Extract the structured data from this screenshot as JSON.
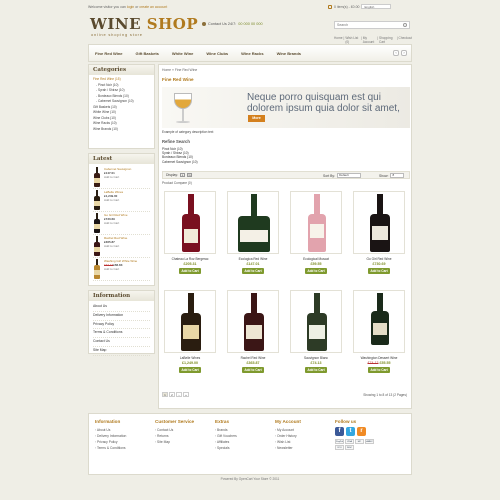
{
  "top": {
    "welcome_text": "Welcome visitor you can",
    "login_link": "login",
    "or_text": "or",
    "create_link": "create an account",
    "cart_text": "0 item(s) - £0.00",
    "language": "English"
  },
  "header": {
    "logo_main": "WINE",
    "logo_accent": "SHOP",
    "tagline": "online shoping store",
    "contact_label": "Contact Us 24/7:",
    "contact_number": "00 000 00 000",
    "search_placeholder": "Search",
    "links": [
      "Home",
      "Wish List (0)",
      "My Account",
      "Shopping Cart",
      "Checkout"
    ]
  },
  "nav": {
    "items": [
      "Fine Red Wine",
      "Gift Baskets",
      "White Wine",
      "Wine Clubs",
      "Wine Racks",
      "Wine Brands"
    ],
    "prev": "‹",
    "next": "›"
  },
  "sidebar": {
    "categories_title": "Categories",
    "categories": [
      {
        "label": "Fine Red Wine (15)",
        "active": true,
        "sub": false
      },
      {
        "label": "- Pinot Noir (10)",
        "active": false,
        "sub": true
      },
      {
        "label": "- Syrah / Shiraz (10)",
        "active": false,
        "sub": true
      },
      {
        "label": "- Bordeaux Blends (10)",
        "active": false,
        "sub": true
      },
      {
        "label": "- Cabernet Sauvignon (10)",
        "active": false,
        "sub": true
      },
      {
        "label": "Gift Baskets (10)",
        "active": false,
        "sub": false
      },
      {
        "label": "White Wine (10)",
        "active": false,
        "sub": false
      },
      {
        "label": "Wine Clubs (10)",
        "active": false,
        "sub": false
      },
      {
        "label": "Wine Racks (10)",
        "active": false,
        "sub": false
      },
      {
        "label": "Wine Brands (10)",
        "active": false,
        "sub": false
      }
    ],
    "latest_title": "Latest",
    "latest": [
      {
        "name": "Cabernet Sauvignon",
        "price": "£147.01",
        "old": "",
        "add": "Add to Cart"
      },
      {
        "name": "LaBelle Wines",
        "price": "£1,249.00",
        "old": "",
        "add": "Add to Cart"
      },
      {
        "name": "Go Girl Red Wine",
        "price": "£730.69",
        "old": "",
        "add": "Add to Cart"
      },
      {
        "name": "Rachel Red Wine",
        "price": "£365.87",
        "old": "",
        "add": "Add to Cart"
      },
      {
        "name": "Washing Girl White Wine",
        "price": "£66.83",
        "old": "£74.13",
        "add": "Add to Cart"
      }
    ],
    "info_title": "Information",
    "info_links": [
      "About Us",
      "Delivery Information",
      "Privacy Policy",
      "Terms & Conditions",
      "Contact Us",
      "Site Map"
    ]
  },
  "main": {
    "breadcrumb": "Home » Fine Red Wine",
    "title": "Fine Red Wine",
    "banner_text_1": "Neque porro quisquam est qui",
    "banner_text_2": "dolorem ipsum quia dolor sit amet,",
    "more_label": "More",
    "category_description": "Example of category description text",
    "refine_title": "Refine Search",
    "refine_items": [
      "Pinot Noir (10)",
      "Syrah / Shiraz (10)",
      "Bordeaux Blends (10)",
      "Cabernet Sauvignon (10)"
    ],
    "display_label": "Display:",
    "view_list": "L",
    "view_grid": "G",
    "sort_label": "Sort By:",
    "sort_value": "Default",
    "show_label": "Show:",
    "show_value": "8",
    "compare_link": "Product Compare (0)",
    "add_label": "Add to Cart",
    "products": [
      {
        "name": "Chateau La Roz Bergerac",
        "price": "£205.31",
        "old": "",
        "bottle": "#7a1020",
        "label": "#f1ead8"
      },
      {
        "name": "Ecologica Red Wine",
        "price": "£147.01",
        "old": "",
        "bottle": "#1f3a1f",
        "label": "#f4f0e6"
      },
      {
        "name": "Ecological Muscat",
        "price": "£59.55",
        "old": "",
        "bottle": "#e2a3ad",
        "label": "#f7f3ea"
      },
      {
        "name": "Go Girl Red Wine",
        "price": "£730.69",
        "old": "",
        "bottle": "#1a1414",
        "label": "#ece7dc"
      },
      {
        "name": "LaBelle Wines",
        "price": "£1,249.00",
        "old": "",
        "bottle": "#2a1d10",
        "label": "#e9d7a6"
      },
      {
        "name": "Rachel Red Wine",
        "price": "£365.87",
        "old": "",
        "bottle": "#3b1616",
        "label": "#ede5d3"
      },
      {
        "name": "Sauvignon Blanc",
        "price": "£74.13",
        "old": "",
        "bottle": "#2d3b26",
        "label": "#eef0e4"
      },
      {
        "name": "Washington Dessert Wine",
        "price": "£55.55",
        "old": "£74.13",
        "bottle": "#1a2a1a",
        "label": "#e4ddc7"
      }
    ],
    "pages": [
      "1",
      "2",
      "›",
      "»"
    ],
    "showing_text": "Showing 1 to 8 of 13 (2 Pages)"
  },
  "footer": {
    "columns": [
      {
        "title": "Information",
        "links": [
          "About Us",
          "Delivery Information",
          "Privacy Policy",
          "Terms & Conditions"
        ]
      },
      {
        "title": "Customer Service",
        "links": [
          "Contact Us",
          "Returns",
          "Site Map"
        ]
      },
      {
        "title": "Extras",
        "links": [
          "Brands",
          "Gift Vouchers",
          "Affiliates",
          "Specials"
        ]
      },
      {
        "title": "My Account",
        "links": [
          "My Account",
          "Order History",
          "Wish List",
          "Newsletter"
        ]
      }
    ],
    "follow_title": "Follow us",
    "payments": [
      "PayPal",
      "VISA",
      "MC",
      "AMEX",
      "2CO",
      "DISC"
    ],
    "powered": "Powered By OpenCart Your Store © 2011"
  },
  "colors": {
    "accent": "#b07a1e",
    "button_green": "#7f9a2e",
    "more_orange": "#d4801e",
    "background": "#efeee6"
  }
}
